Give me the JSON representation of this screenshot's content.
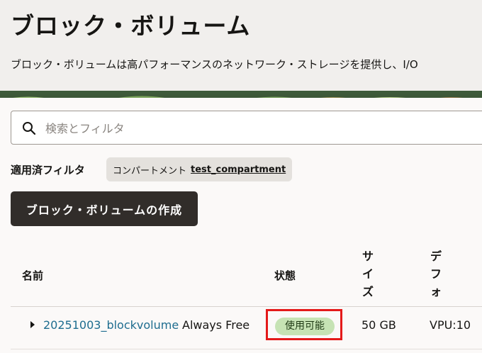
{
  "header": {
    "title": "ブロック・ボリューム",
    "description": "ブロック・ボリュームは高パフォーマンスのネットワーク・ストレージを提供し、I/O"
  },
  "search": {
    "placeholder": "検索とフィルタ",
    "icon": "search-icon"
  },
  "filters": {
    "applied_label": "適用済フィルタ",
    "chip_key": "コンパートメント",
    "chip_value": "test_compartment"
  },
  "actions": {
    "create_label": "ブロック・ボリュームの作成"
  },
  "table": {
    "columns": {
      "name": "名前",
      "state": "状態",
      "size": [
        "サ",
        "イ",
        "ズ"
      ],
      "default": [
        "デ",
        "フ",
        "ォ"
      ]
    },
    "rows": [
      {
        "name": "20251003_blockvolume",
        "tier": "Always Free",
        "state": "使用可能",
        "size": "50 GB",
        "vpu": "VPU:10"
      }
    ]
  },
  "colors": {
    "link": "#1e6d8f",
    "badge_available": "#c6e3b4",
    "highlight": "#e41a1a",
    "primary_button": "#312d2a"
  }
}
